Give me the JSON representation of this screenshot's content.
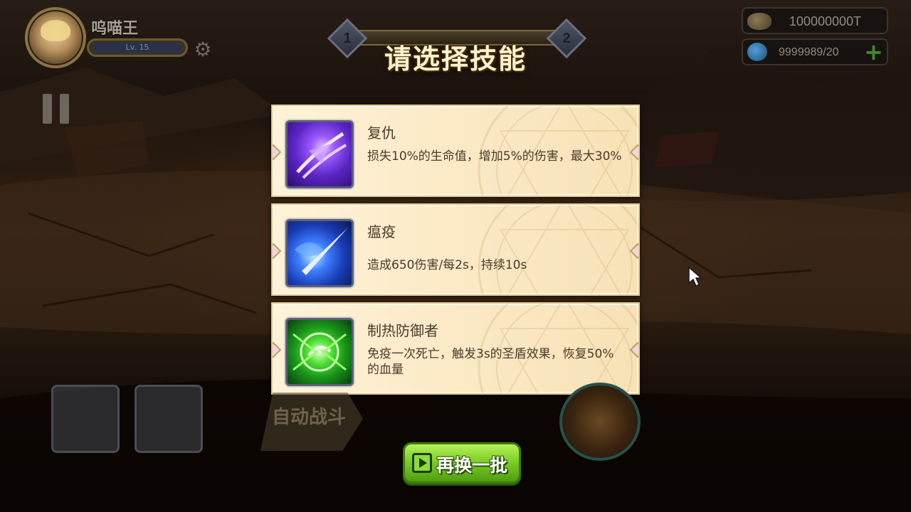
{
  "header": {
    "player_name": "呜喵王",
    "level": "Lv. 15"
  },
  "resources": {
    "gold": "100000000T",
    "energy": "9999989/20"
  },
  "panel": {
    "title": "请选择技能",
    "stages": [
      "1",
      "2"
    ]
  },
  "skills": [
    {
      "name": "复仇",
      "description": "损失10%的生命值，增加5%的伤害，最大30%",
      "icon": "revenge-claw-icon"
    },
    {
      "name": "瘟疫",
      "description": "造成650伤害/每2s，持续10s",
      "icon": "plague-blade-icon"
    },
    {
      "name": "制热防御者",
      "description": "免疫一次死亡，触发3s的圣盾效果，恢复50%的血量",
      "icon": "green-shield-orb-icon"
    }
  ],
  "hud": {
    "auto_battle_label": "自动战斗",
    "refresh_label": "再换一批"
  },
  "colors": {
    "card_bg": "#fbe8c4",
    "card_text": "#4a3a2a",
    "title_text": "#fff3cf",
    "refresh_button": "#7ecf26"
  }
}
